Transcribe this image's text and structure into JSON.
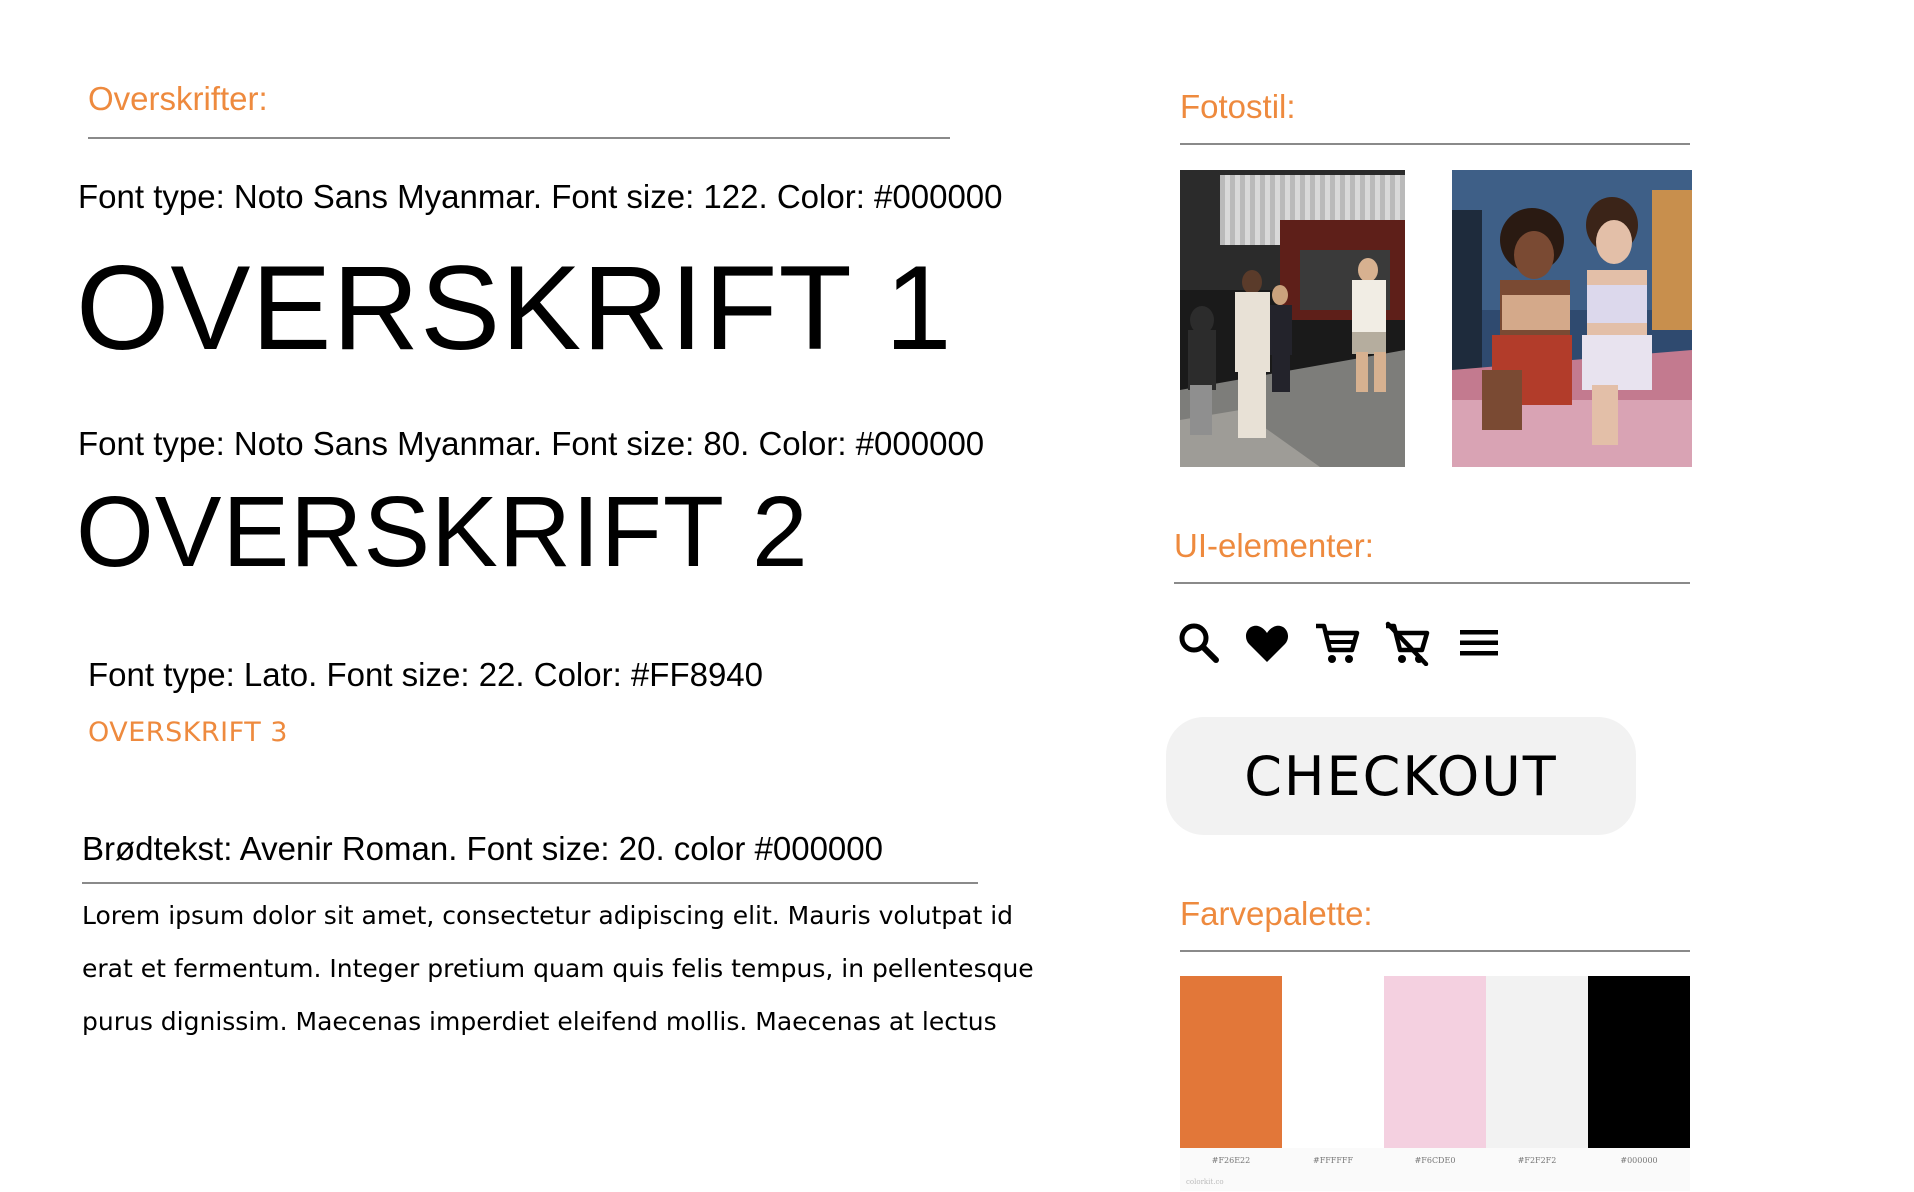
{
  "headings": {
    "title": "Overskrifter:",
    "h1_spec": "Font type: Noto Sans Myanmar. Font size: 122. Color: #000000",
    "h1_sample": "OVERSKRIFT 1",
    "h2_spec": "Font type: Noto Sans Myanmar. Font size: 80. Color: #000000",
    "h2_sample": "OVERSKRIFT 2",
    "h3_spec": "Font type: Lato. Font size: 22. Color: #FF8940",
    "h3_sample": "OVERSKRIFT 3"
  },
  "body_text": {
    "spec": "Brødtekst: Avenir Roman. Font size: 20. color #000000",
    "lines": [
      "Lorem ipsum dolor sit amet, consectetur adipiscing elit. Mauris volutpat id",
      "erat et fermentum. Integer pretium quam quis felis tempus, in pellentesque",
      "purus dignissim. Maecenas imperdiet eleifend mollis. Maecenas at lectus"
    ]
  },
  "photo_style": {
    "title": "Fotostil:"
  },
  "ui_elements": {
    "title": "UI-elementer:",
    "icons": [
      "search-icon",
      "heart-icon",
      "cart-icon",
      "cart-remove-icon",
      "menu-icon"
    ],
    "checkout_label": "CHECKOUT"
  },
  "palette": {
    "title": "Farvepalette:",
    "swatches": [
      {
        "hex": "#E27739",
        "label": "#F26E22"
      },
      {
        "hex": "#FFFFFF",
        "label": "#FFFFFF"
      },
      {
        "hex": "#F4D0E0",
        "label": "#F6CDE0"
      },
      {
        "hex": "#F2F2F2",
        "label": "#F2F2F2"
      },
      {
        "hex": "#000000",
        "label": "#000000"
      }
    ],
    "credit": "colorkit.co"
  },
  "colors": {
    "accent": "#EE8A3E",
    "rule": "#8A8A8A",
    "button_bg": "#F2F2F2"
  }
}
